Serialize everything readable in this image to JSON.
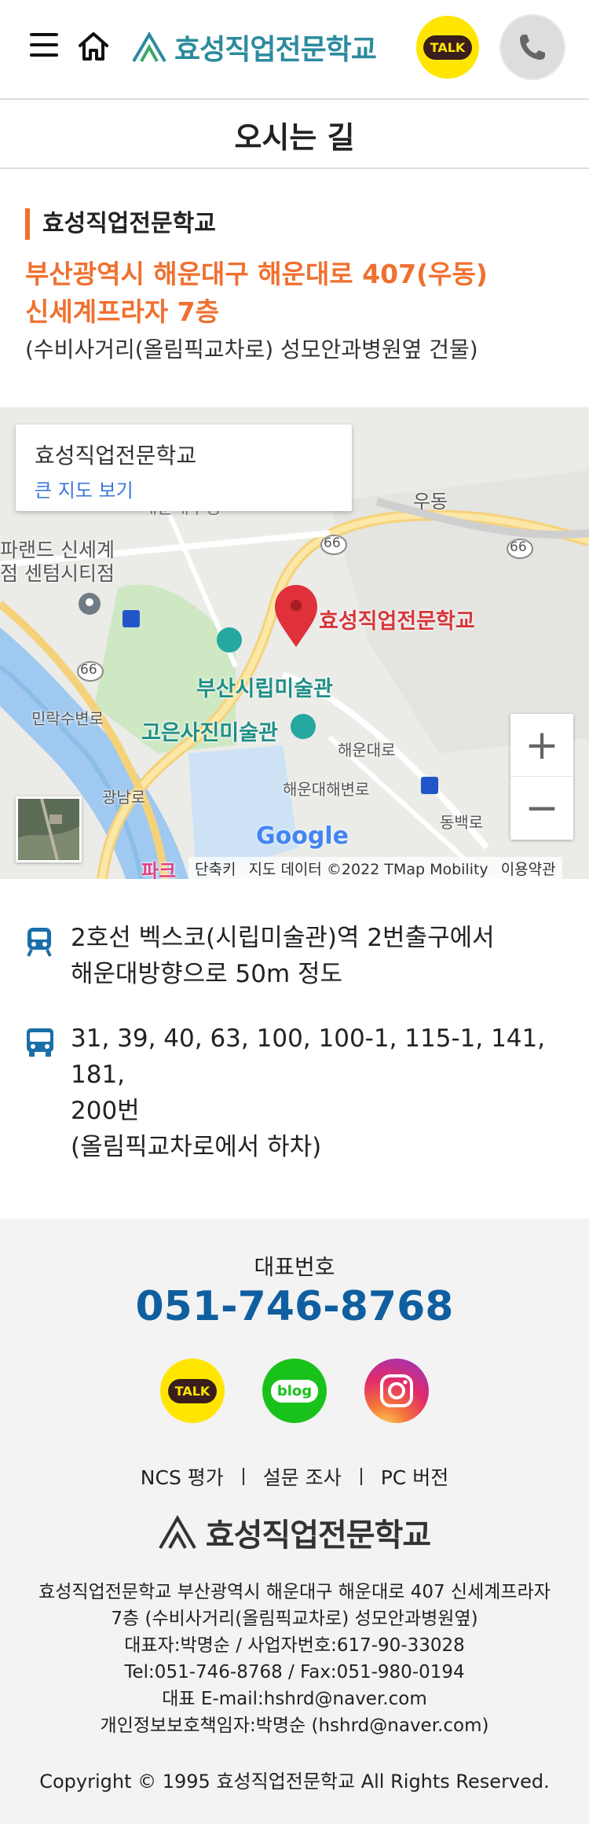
{
  "header": {
    "logo_text": "효성직업전문학교",
    "kakao_label": "TALK"
  },
  "page": {
    "title": "오시는 길"
  },
  "address": {
    "school_name": "효성직업전문학교",
    "line1": "부산광역시 해운대구 해운대로 407(우동)",
    "line2": "신세계프라자 7층",
    "note": "(수비사거리(올림픽교차로) 성모안과병원옆 건물)"
  },
  "map": {
    "card_name": "효성직업전문학교",
    "card_link": "큰 지도 보기",
    "pin_label": "효성직업전문학교",
    "labels": {
      "udong": "우동",
      "centum_1": "파랜드 신세계",
      "centum_2": "점 센텀시티점",
      "museum": "부산시립미술관",
      "photo": "고은사진미술관",
      "haeundae_ro": "해운대로",
      "minrak": "민락수변로",
      "gwangan": "광남로",
      "haeundae_beach": "해운대해변로",
      "dongbaek": "동백로",
      "road66_a": "66",
      "road66_b": "66",
      "road66_c": "66",
      "partial_top": "해운대구청",
      "partial_bottom": "파크"
    },
    "google": "Google",
    "footer": {
      "shortcut": "단축키",
      "data": "지도 데이터 ©2022 TMap Mobility",
      "terms": "이용약관"
    },
    "zoom_in": "+",
    "zoom_out": "−"
  },
  "transit": [
    {
      "icon": "subway-icon",
      "lines": [
        "2호선 벡스코(시립미술관)역 2번출구에서",
        "해운대방향으로 50m 정도"
      ]
    },
    {
      "icon": "bus-icon",
      "lines": [
        "31, 39, 40, 63, 100, 100-1, 115-1, 141, 181,",
        "200번",
        "(올림픽교차로에서 하차)"
      ]
    }
  ],
  "footer": {
    "phone_label": "대표번호",
    "phone": "051-746-8768",
    "kakao": "TALK",
    "blog": "blog",
    "links": [
      "NCS 평가",
      "설문 조사",
      "PC 버전"
    ],
    "logo_text": "효성직업전문학교",
    "info": [
      "효성직업전문학교 부산광역시 해운대구 해운대로 407 신세계프라자",
      "7층 (수비사거리(올림픽교차로) 성모안과병원옆)",
      "대표자:박명순 / 사업자번호:617-90-33028",
      "Tel:051-746-8768 / Fax:051-980-0194",
      "대표 E-mail:hshrd@naver.com",
      "개인정보보호책임자:박명순 (hshrd@naver.com)"
    ],
    "copyright": "Copyright © 1995 효성직업전문학교 All Rights Reserved."
  },
  "colors": {
    "accent_orange": "#f07030",
    "phone_blue": "#0f5fa0",
    "logo_teal": "#2c8b9e",
    "kakao_yellow": "#ffe500",
    "blog_green": "#19c21b"
  }
}
